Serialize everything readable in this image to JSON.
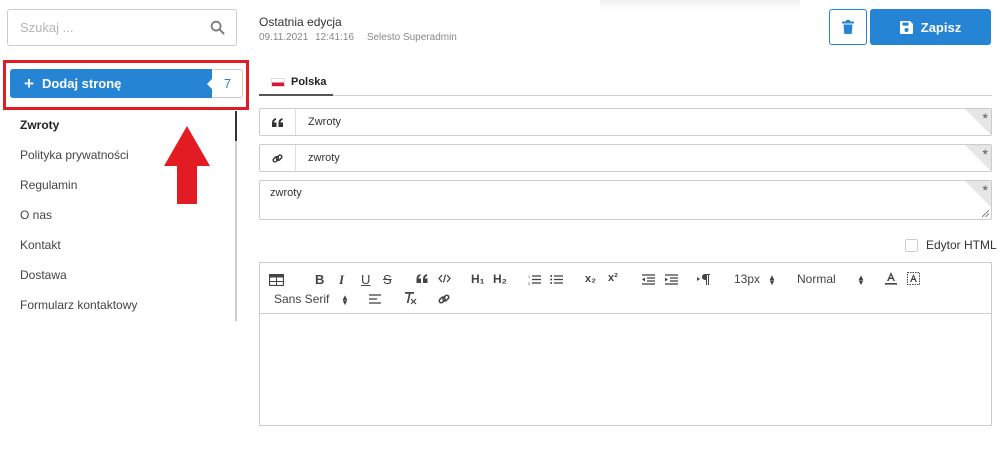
{
  "search": {
    "placeholder": "Szukaj ...",
    "icon": "search-icon"
  },
  "sidebar": {
    "add_label": "Dodaj stronę",
    "count": "7",
    "pages": [
      {
        "label": "Zwroty",
        "active": true
      },
      {
        "label": "Polityka prywatności",
        "active": false
      },
      {
        "label": "Regulamin",
        "active": false
      },
      {
        "label": "O nas",
        "active": false
      },
      {
        "label": "Kontakt",
        "active": false
      },
      {
        "label": "Dostawa",
        "active": false
      },
      {
        "label": "Formularz kontaktowy",
        "active": false
      }
    ]
  },
  "header": {
    "last_edit_label": "Ostatnia edycja",
    "date": "09.11.2021",
    "time": "12:41:16",
    "user": "Selesto Superadmin",
    "save_label": "Zapisz"
  },
  "language_tab": {
    "label": "Polska"
  },
  "form": {
    "title_value": "Zwroty",
    "slug_value": "zwroty",
    "description_value": "zwroty",
    "required_mark": "*"
  },
  "html_editor": {
    "label": "Edytor HTML",
    "checked": false
  },
  "toolbar": {
    "bold": "B",
    "italic": "I",
    "underline": "U",
    "strike": "S",
    "h1": "H₁",
    "h2": "H₂",
    "subscript": "x₂",
    "superscript": "x²",
    "size_value": "13px",
    "header_value": "Normal",
    "font_value": "Sans Serif"
  },
  "colors": {
    "accent": "#2684d4",
    "highlight_frame": "#e31b23"
  }
}
